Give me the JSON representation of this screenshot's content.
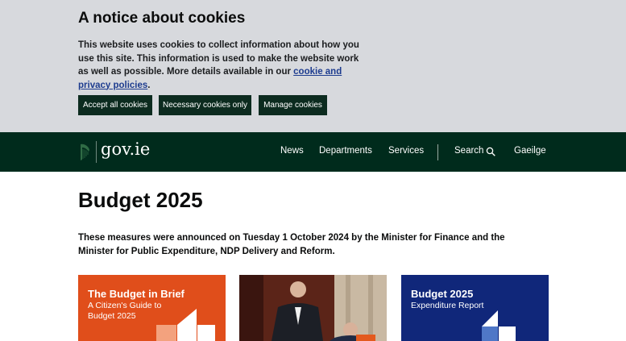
{
  "cookie_banner": {
    "title": "A notice about cookies",
    "text_before_link": "This website uses cookies to collect information about how you use this site. This information is used to make the website work as well as possible. More details available in our ",
    "link_text": "cookie and privacy policies",
    "text_after_link": ".",
    "buttons": {
      "accept": "Accept all cookies",
      "necessary": "Necessary cookies only",
      "manage": "Manage cookies"
    }
  },
  "header": {
    "logo_text": "gov.ie",
    "nav": {
      "news": "News",
      "departments": "Departments",
      "services": "Services",
      "search": "Search",
      "gaeilge": "Gaeilge"
    }
  },
  "main": {
    "title": "Budget 2025",
    "intro": "These measures were announced on Tuesday 1 October 2024 by the Minister for Finance and the Minister for Public Expenditure, NDP Delivery and Reform.",
    "cards": [
      {
        "title": "The Budget in Brief",
        "subtitle": "A Citizen's Guide to Budget 2025"
      },
      {
        "title": "",
        "subtitle": ""
      },
      {
        "title": "Budget 2025",
        "subtitle": "Expenditure Report"
      }
    ]
  },
  "colors": {
    "header_bg": "#002b1c",
    "cookie_bg": "#d7d9dd",
    "button_bg": "#0c2b1f",
    "card_orange": "#e04e1b",
    "card_navy": "#10277a",
    "link": "#1d3c8f"
  }
}
